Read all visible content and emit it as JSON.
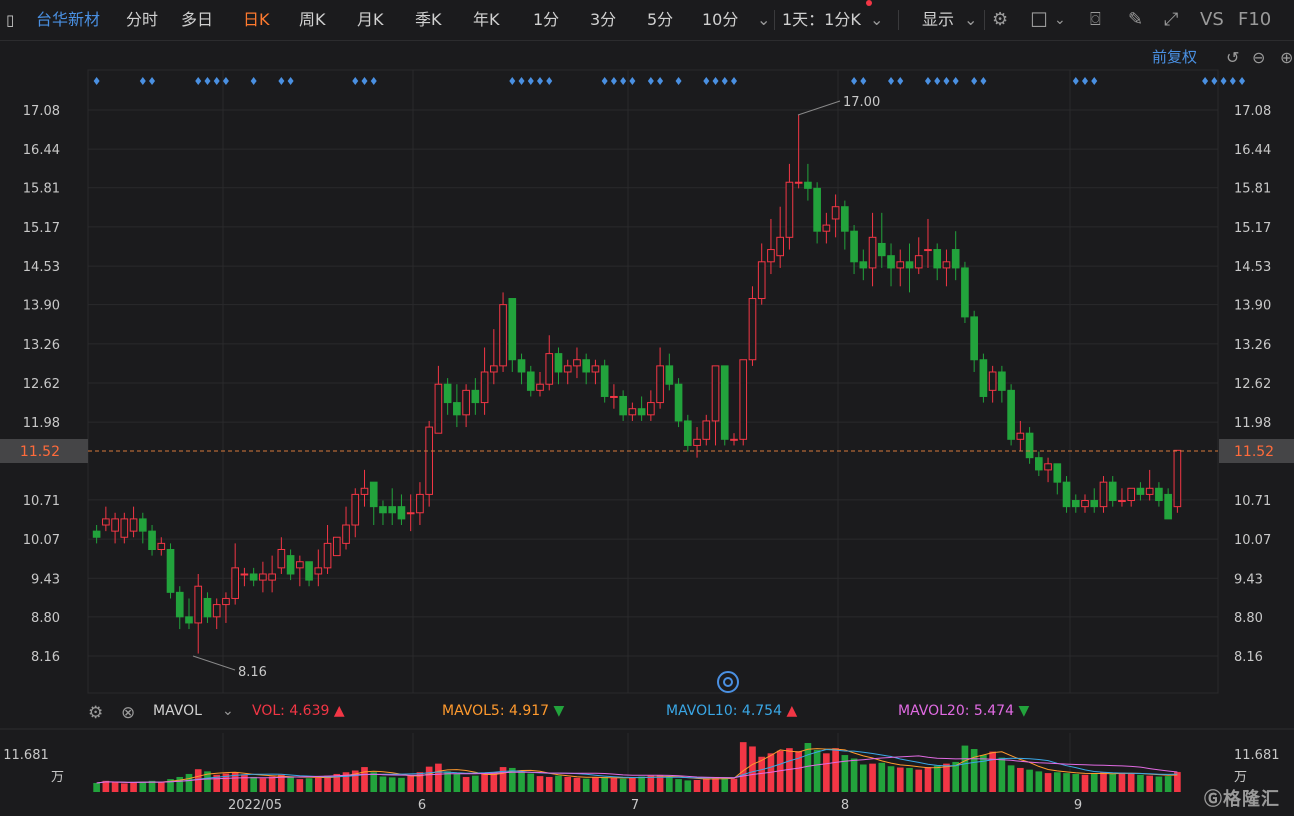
{
  "toolbar": {
    "stock_name": "台华新材",
    "periods": [
      "分时",
      "多日",
      "日K",
      "周K",
      "月K",
      "季K",
      "年K",
      "1分",
      "3分",
      "5分",
      "10分"
    ],
    "active_period": "日K",
    "more_chevron": "⌄",
    "interval_select": "1天：1分K",
    "display_label": "显示",
    "vs_label": "VS",
    "f10_label": "F10"
  },
  "chart_header": {
    "adjust_label": "前复权"
  },
  "price_axis": {
    "ticks": [
      "17.08",
      "16.44",
      "15.81",
      "15.17",
      "14.53",
      "13.90",
      "13.26",
      "12.62",
      "11.98",
      "11.52",
      "10.71",
      "10.07",
      "9.43",
      "8.80",
      "8.16"
    ],
    "current_price": "11.52",
    "high_label": "17.00",
    "low_label": "8.16"
  },
  "volume_panel": {
    "indicator_name": "MAVOL",
    "vol_label": "VOL:",
    "vol_value": "4.639",
    "mavol5_label": "MAVOL5:",
    "mavol5_value": "4.917",
    "mavol10_label": "MAVOL10:",
    "mavol10_value": "4.754",
    "mavol20_label": "MAVOL20:",
    "mavol20_value": "5.474",
    "axis_value": "11.681",
    "axis_unit": "万"
  },
  "date_axis": [
    "2022/05",
    "6",
    "7",
    "8",
    "9"
  ],
  "logo": "格隆汇",
  "colors": {
    "up": "#f23645",
    "down": "#22a33c",
    "accent": "#ff7a2f",
    "blue": "#4a90e2",
    "mavol5": "#ff9a2e",
    "mavol10": "#3aa7e6",
    "mavol20": "#e16be3"
  },
  "chart_data": {
    "type": "candlestick",
    "ylim": [
      7.9,
      17.4
    ],
    "candles": [
      [
        10.2,
        10.1,
        10.3,
        10.0
      ],
      [
        10.3,
        10.4,
        10.6,
        10.2
      ],
      [
        10.2,
        10.4,
        10.5,
        10.0
      ],
      [
        10.1,
        10.4,
        10.5,
        10.0
      ],
      [
        10.2,
        10.4,
        10.6,
        10.1
      ],
      [
        10.4,
        10.2,
        10.5,
        10.0
      ],
      [
        10.2,
        9.9,
        10.3,
        9.8
      ],
      [
        9.9,
        10.0,
        10.1,
        9.8
      ],
      [
        9.9,
        9.2,
        10.0,
        9.1
      ],
      [
        9.2,
        8.8,
        9.3,
        8.6
      ],
      [
        8.8,
        8.7,
        9.1,
        8.6
      ],
      [
        8.7,
        9.3,
        9.5,
        8.2
      ],
      [
        9.1,
        8.8,
        9.2,
        8.7
      ],
      [
        8.8,
        9.0,
        9.1,
        8.6
      ],
      [
        9.0,
        9.1,
        9.2,
        8.7
      ],
      [
        9.1,
        9.6,
        10.0,
        9.0
      ],
      [
        9.5,
        9.5,
        9.6,
        9.3
      ],
      [
        9.5,
        9.4,
        9.6,
        9.3
      ],
      [
        9.4,
        9.5,
        9.7,
        9.2
      ],
      [
        9.4,
        9.5,
        9.8,
        9.2
      ],
      [
        9.6,
        9.9,
        10.1,
        9.5
      ],
      [
        9.8,
        9.5,
        9.9,
        9.4
      ],
      [
        9.6,
        9.7,
        9.8,
        9.3
      ],
      [
        9.7,
        9.4,
        9.6,
        9.3
      ],
      [
        9.5,
        9.6,
        9.9,
        9.3
      ],
      [
        9.6,
        10.0,
        10.3,
        9.5
      ],
      [
        9.8,
        10.1,
        10.1,
        9.8
      ],
      [
        10.0,
        10.3,
        10.6,
        9.9
      ],
      [
        10.3,
        10.8,
        10.9,
        10.1
      ],
      [
        10.8,
        10.9,
        11.2,
        10.6
      ],
      [
        11.0,
        10.6,
        11.0,
        10.3
      ],
      [
        10.6,
        10.5,
        10.7,
        10.3
      ],
      [
        10.6,
        10.5,
        10.9,
        10.3
      ],
      [
        10.6,
        10.4,
        10.8,
        10.3
      ],
      [
        10.5,
        10.5,
        10.8,
        10.2
      ],
      [
        10.5,
        10.8,
        11.0,
        10.3
      ],
      [
        10.8,
        11.9,
        12.0,
        10.6
      ],
      [
        11.8,
        12.6,
        12.9,
        11.8
      ],
      [
        12.6,
        12.3,
        12.7,
        12.1
      ],
      [
        12.3,
        12.1,
        12.6,
        11.9
      ],
      [
        12.1,
        12.5,
        12.6,
        11.9
      ],
      [
        12.5,
        12.3,
        12.7,
        12.1
      ],
      [
        12.3,
        12.8,
        13.2,
        12.1
      ],
      [
        12.8,
        12.9,
        13.5,
        12.6
      ],
      [
        12.9,
        13.9,
        14.1,
        12.8
      ],
      [
        14.0,
        13.0,
        14.0,
        12.8
      ],
      [
        13.0,
        12.8,
        13.1,
        12.6
      ],
      [
        12.8,
        12.5,
        12.9,
        12.4
      ],
      [
        12.5,
        12.6,
        12.8,
        12.4
      ],
      [
        12.6,
        13.1,
        13.4,
        12.5
      ],
      [
        13.1,
        12.8,
        13.2,
        12.6
      ],
      [
        12.8,
        12.9,
        13.0,
        12.6
      ],
      [
        12.9,
        13.0,
        13.2,
        12.7
      ],
      [
        13.0,
        12.8,
        13.1,
        12.6
      ],
      [
        12.8,
        12.9,
        13.0,
        12.6
      ],
      [
        12.9,
        12.4,
        13.0,
        12.3
      ],
      [
        12.4,
        12.4,
        12.6,
        12.2
      ],
      [
        12.4,
        12.1,
        12.5,
        12.0
      ],
      [
        12.1,
        12.2,
        12.3,
        12.0
      ],
      [
        12.2,
        12.1,
        12.4,
        12.0
      ],
      [
        12.1,
        12.3,
        12.5,
        12.0
      ],
      [
        12.3,
        12.9,
        13.2,
        12.2
      ],
      [
        12.9,
        12.6,
        13.1,
        12.5
      ],
      [
        12.6,
        12.0,
        12.7,
        11.9
      ],
      [
        12.0,
        11.6,
        12.1,
        11.5
      ],
      [
        11.6,
        11.7,
        11.9,
        11.4
      ],
      [
        11.7,
        12.0,
        12.1,
        11.6
      ],
      [
        12.0,
        12.9,
        12.9,
        11.6
      ],
      [
        12.9,
        11.7,
        12.9,
        11.6
      ],
      [
        11.7,
        11.7,
        11.8,
        11.6
      ],
      [
        11.7,
        13.0,
        13.0,
        11.6
      ],
      [
        13.0,
        14.0,
        14.2,
        12.9
      ],
      [
        14.0,
        14.6,
        14.9,
        13.9
      ],
      [
        14.6,
        14.8,
        15.3,
        14.4
      ],
      [
        14.7,
        15.0,
        15.5,
        14.5
      ],
      [
        15.0,
        15.9,
        16.2,
        14.8
      ],
      [
        15.9,
        15.9,
        17.0,
        15.8
      ],
      [
        15.9,
        15.8,
        16.2,
        15.6
      ],
      [
        15.8,
        15.1,
        15.9,
        14.9
      ],
      [
        15.1,
        15.2,
        15.4,
        14.9
      ],
      [
        15.3,
        15.5,
        15.7,
        15.0
      ],
      [
        15.5,
        15.1,
        15.6,
        14.8
      ],
      [
        15.1,
        14.6,
        15.2,
        14.4
      ],
      [
        14.6,
        14.5,
        14.8,
        14.3
      ],
      [
        14.5,
        15.0,
        15.4,
        14.2
      ],
      [
        14.9,
        14.7,
        15.4,
        14.5
      ],
      [
        14.7,
        14.5,
        14.9,
        14.2
      ],
      [
        14.5,
        14.6,
        14.8,
        14.2
      ],
      [
        14.6,
        14.5,
        14.9,
        14.1
      ],
      [
        14.5,
        14.7,
        15.0,
        14.4
      ],
      [
        14.8,
        14.8,
        15.3,
        14.5
      ],
      [
        14.8,
        14.5,
        14.9,
        14.3
      ],
      [
        14.5,
        14.6,
        14.8,
        14.2
      ],
      [
        14.8,
        14.5,
        15.1,
        14.3
      ],
      [
        14.5,
        13.7,
        14.6,
        13.6
      ],
      [
        13.7,
        13.0,
        13.8,
        12.8
      ],
      [
        13.0,
        12.4,
        13.1,
        12.3
      ],
      [
        12.5,
        12.8,
        12.9,
        12.3
      ],
      [
        12.8,
        12.5,
        12.9,
        12.3
      ],
      [
        12.5,
        11.7,
        12.6,
        11.6
      ],
      [
        11.7,
        11.8,
        12.0,
        11.5
      ],
      [
        11.8,
        11.4,
        11.9,
        11.3
      ],
      [
        11.4,
        11.2,
        11.5,
        11.1
      ],
      [
        11.2,
        11.3,
        11.4,
        11.0
      ],
      [
        11.3,
        11.0,
        11.3,
        10.8
      ],
      [
        11.0,
        10.6,
        11.1,
        10.5
      ],
      [
        10.7,
        10.6,
        10.8,
        10.5
      ],
      [
        10.6,
        10.7,
        10.8,
        10.5
      ],
      [
        10.7,
        10.6,
        10.9,
        10.5
      ],
      [
        10.6,
        11.0,
        11.1,
        10.5
      ],
      [
        11.0,
        10.7,
        11.1,
        10.6
      ],
      [
        10.7,
        10.7,
        10.9,
        10.6
      ],
      [
        10.7,
        10.9,
        10.9,
        10.6
      ],
      [
        10.9,
        10.8,
        11.0,
        10.7
      ],
      [
        10.8,
        10.9,
        11.2,
        10.7
      ],
      [
        10.9,
        10.7,
        11.0,
        10.6
      ],
      [
        10.8,
        10.4,
        10.9,
        10.4
      ],
      [
        10.6,
        11.52,
        11.52,
        10.5
      ]
    ],
    "volume": [
      2.1,
      2.6,
      2.3,
      2.0,
      2.2,
      2.4,
      2.6,
      2.3,
      3.0,
      3.5,
      4.2,
      5.3,
      4.8,
      4.0,
      4.3,
      4.6,
      4.1,
      3.5,
      3.2,
      3.6,
      4.0,
      3.5,
      3.0,
      3.2,
      3.3,
      3.8,
      4.2,
      4.6,
      5.0,
      5.8,
      4.6,
      3.6,
      3.4,
      3.3,
      3.8,
      4.6,
      5.9,
      6.6,
      4.8,
      4.2,
      3.5,
      3.8,
      4.2,
      4.6,
      5.8,
      5.6,
      4.8,
      4.3,
      3.7,
      3.5,
      3.8,
      3.5,
      3.3,
      3.1,
      3.4,
      3.5,
      3.3,
      3.1,
      3.3,
      3.6,
      3.8,
      3.9,
      3.4,
      3.0,
      2.7,
      2.8,
      3.2,
      3.5,
      3.3,
      3.1,
      11.6,
      10.6,
      8.2,
      9.0,
      9.6,
      10.2,
      9.5,
      11.4,
      9.8,
      9.0,
      10.2,
      8.6,
      7.8,
      6.4,
      6.6,
      6.8,
      6.0,
      5.7,
      5.6,
      5.2,
      5.8,
      6.1,
      6.6,
      7.0,
      10.8,
      10.0,
      8.6,
      9.4,
      8.0,
      6.2,
      5.6,
      5.2,
      4.8,
      4.4,
      4.6,
      4.4,
      4.2,
      4.0,
      4.3,
      4.6,
      4.2,
      4.5,
      4.3,
      4.0,
      3.8,
      3.6,
      3.7,
      4.639
    ],
    "volume_ylim": [
      0,
      12.8
    ],
    "signals": [
      0,
      5,
      6,
      11,
      12,
      13,
      14,
      17,
      20,
      21,
      28,
      29,
      30,
      45,
      46,
      47,
      48,
      49,
      55,
      56,
      57,
      58,
      60,
      61,
      63,
      66,
      67,
      68,
      69,
      82,
      83,
      86,
      87,
      90,
      91,
      92,
      93,
      95,
      96,
      106,
      107,
      108,
      120,
      121,
      122,
      123,
      124
    ]
  }
}
